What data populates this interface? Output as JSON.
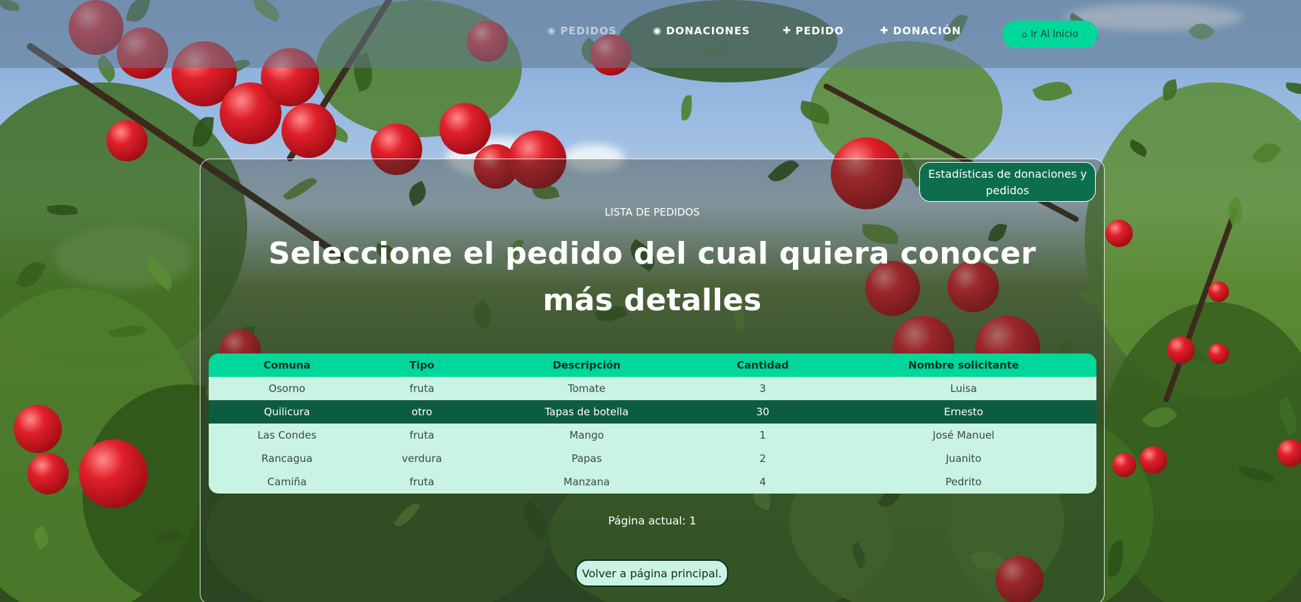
{
  "nav": {
    "items": [
      {
        "label": "Pedidos",
        "icon": "eye-icon"
      },
      {
        "label": "Donaciones",
        "icon": "eye-icon"
      },
      {
        "label": "Pedido",
        "icon": "plus-icon"
      },
      {
        "label": "Donación",
        "icon": "plus-icon"
      }
    ],
    "home_label": "Ir Al Inicio",
    "home_icon": "home-icon",
    "accent_color": "#00d79a"
  },
  "main": {
    "stats_button": "Estadísticas de donaciones y pedidos",
    "eyebrow": "LISTA DE PEDIDOS",
    "title": "Seleccione el pedido del cual quiera conocer más detalles",
    "table": {
      "headers": [
        "Comuna",
        "Tipo",
        "Descripción",
        "Cantidad",
        "Nombre solicitante"
      ],
      "rows": [
        [
          "Osorno",
          "fruta",
          "Tomate",
          "3",
          "Luisa"
        ],
        [
          "Quilicura",
          "otro",
          "Tapas de botella",
          "30",
          "Ernesto"
        ],
        [
          "Las Condes",
          "fruta",
          "Mango",
          "1",
          "José Manuel"
        ],
        [
          "Rancagua",
          "verdura",
          "Papas",
          "2",
          "Juanito"
        ],
        [
          "Camiña",
          "fruta",
          "Manzana",
          "4",
          "Pedrito"
        ]
      ],
      "selected_row": 1
    },
    "page_info": "Página actual: 1",
    "back_button": "Volver a página principal."
  }
}
